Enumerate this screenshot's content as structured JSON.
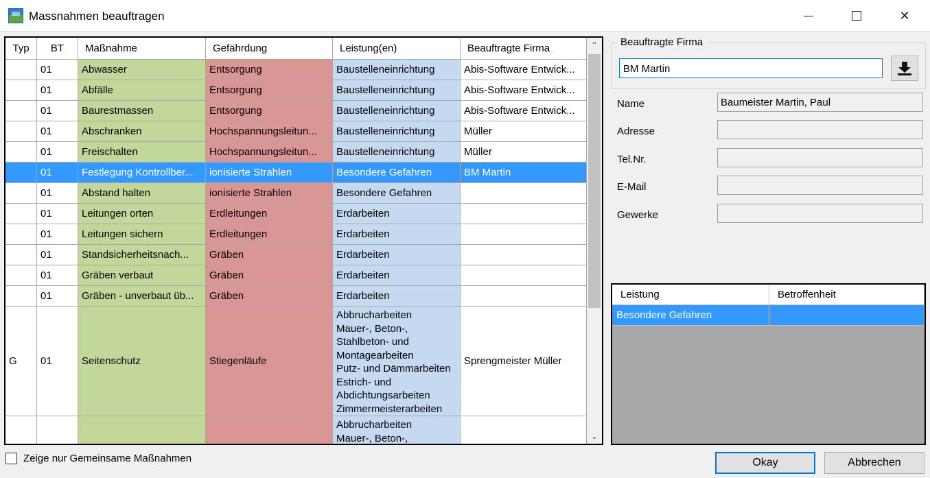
{
  "window": {
    "title": "Massnahmen beauftragen"
  },
  "grid": {
    "columns": [
      "Typ",
      "BT",
      "Maßnahme",
      "Gefährdung",
      "Leistung(en)",
      "Beauftragte Firma"
    ],
    "rows": [
      {
        "typ": "",
        "bt": "01",
        "massnahme": "Abwasser",
        "gefaehrdung": "Entsorgung",
        "leistung": "Baustelleneinrichtung",
        "firma": "Abis-Software Entwick..."
      },
      {
        "typ": "",
        "bt": "01",
        "massnahme": "Abfälle",
        "gefaehrdung": "Entsorgung",
        "leistung": "Baustelleneinrichtung",
        "firma": "Abis-Software Entwick..."
      },
      {
        "typ": "",
        "bt": "01",
        "massnahme": "Baurestmassen",
        "gefaehrdung": "Entsorgung",
        "leistung": "Baustelleneinrichtung",
        "firma": "Abis-Software Entwick..."
      },
      {
        "typ": "",
        "bt": "01",
        "massnahme": "Abschranken",
        "gefaehrdung": "Hochspannungsleitun...",
        "leistung": "Baustelleneinrichtung",
        "firma": "Müller"
      },
      {
        "typ": "",
        "bt": "01",
        "massnahme": "Freischalten",
        "gefaehrdung": "Hochspannungsleitun...",
        "leistung": "Baustelleneinrichtung",
        "firma": "Müller"
      },
      {
        "typ": "",
        "bt": "01",
        "massnahme": "Festlegung Kontrollber...",
        "gefaehrdung": "ionisierte Strahlen",
        "leistung": "Besondere Gefahren",
        "firma": "BM Martin",
        "selected": true
      },
      {
        "typ": "",
        "bt": "01",
        "massnahme": "Abstand halten",
        "gefaehrdung": "ionisierte Strahlen",
        "leistung": "Besondere Gefahren",
        "firma": ""
      },
      {
        "typ": "",
        "bt": "01",
        "massnahme": "Leitungen orten",
        "gefaehrdung": "Erdleitungen",
        "leistung": "Erdarbeiten",
        "firma": ""
      },
      {
        "typ": "",
        "bt": "01",
        "massnahme": "Leitungen sichern",
        "gefaehrdung": "Erdleitungen",
        "leistung": "Erdarbeiten",
        "firma": ""
      },
      {
        "typ": "",
        "bt": "01",
        "massnahme": "Standsicherheitsnach...",
        "gefaehrdung": "Gräben",
        "leistung": "Erdarbeiten",
        "firma": ""
      },
      {
        "typ": "",
        "bt": "01",
        "massnahme": "Gräben verbaut",
        "gefaehrdung": "Gräben",
        "leistung": "Erdarbeiten",
        "firma": ""
      },
      {
        "typ": "",
        "bt": "01",
        "massnahme": "Gräben - unverbaut üb...",
        "gefaehrdung": "Gräben",
        "leistung": "Erdarbeiten",
        "firma": ""
      }
    ],
    "tall_row": {
      "typ": "G",
      "bt": "01",
      "massnahme": "Seitenschutz",
      "gefaehrdung": "Stiegenläufe",
      "leistung": "Abbrucharbeiten\nMauer-, Beton-,\nStahlbeton- und\nMontagearbeiten\nPutz- und Dämmarbeiten\nEstrich- und\nAbdichtungsarbeiten\nZimmermeisterarbeiten",
      "firma": "Sprengmeister Müller"
    },
    "partial_row": {
      "typ": "",
      "bt": "",
      "massnahme": "",
      "gefaehrdung": "",
      "leistung": "Abbrucharbeiten\nMauer-, Beton-,",
      "firma": ""
    }
  },
  "filter": {
    "checkbox_label": "Zeige nur Gemeinsame Maßnahmen"
  },
  "firma_panel": {
    "legend": "Beauftragte Firma",
    "input_value": "BM Martin",
    "fields": [
      {
        "label": "Name",
        "value": "Baumeister Martin, Paul"
      },
      {
        "label": "Adresse",
        "value": ""
      },
      {
        "label": "Tel.Nr.",
        "value": ""
      },
      {
        "label": "E-Mail",
        "value": ""
      },
      {
        "label": "Gewerke",
        "value": ""
      }
    ]
  },
  "leistung_grid": {
    "columns": [
      "Leistung",
      "Betroffenheit"
    ],
    "rows": [
      {
        "leistung": "Besondere Gefahren",
        "betroffenheit": ""
      }
    ]
  },
  "buttons": {
    "ok": "Okay",
    "cancel": "Abbrechen"
  }
}
